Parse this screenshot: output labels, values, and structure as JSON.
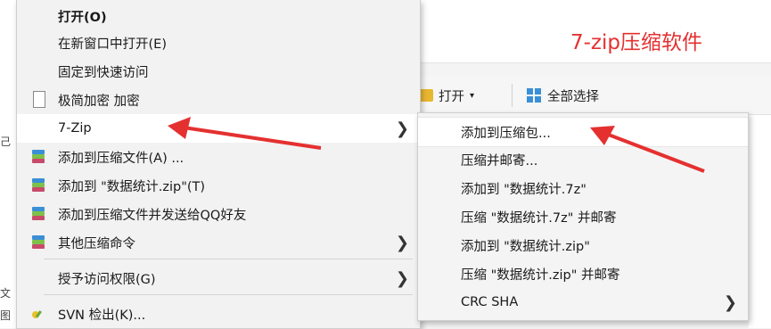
{
  "caption": "7-zip压缩软件",
  "ribbon": {
    "open_label": "打开",
    "open_caret": "▾",
    "select_all_label": "全部选择"
  },
  "bg_fragments": [
    "己",
    "文",
    "¿",
    "图"
  ],
  "main_menu": {
    "items": [
      {
        "label": "打开(O)",
        "bold": true
      },
      {
        "label": "在新窗口中打开(E)"
      },
      {
        "label": "固定到快速访问"
      },
      {
        "label": "极简加密 加密"
      },
      {
        "label": "7-Zip",
        "has_submenu": true,
        "highlighted": true
      },
      {
        "label": "添加到压缩文件(A) ..."
      },
      {
        "label": "添加到 \"数据统计.zip\"(T)"
      },
      {
        "label": "添加到压缩文件并发送给QQ好友"
      },
      {
        "label": "其他压缩命令",
        "has_submenu": true
      },
      {
        "label": "授予访问权限(G)",
        "has_submenu": true
      },
      {
        "label": "SVN 检出(K)..."
      }
    ]
  },
  "sub_menu": {
    "items": [
      {
        "label": "添加到压缩包...",
        "highlighted": true
      },
      {
        "label": "压缩并邮寄..."
      },
      {
        "label": "添加到 \"数据统计.7z\""
      },
      {
        "label": "压缩 \"数据统计.7z\" 并邮寄"
      },
      {
        "label": "添加到 \"数据统计.zip\""
      },
      {
        "label": "压缩 \"数据统计.zip\" 并邮寄"
      },
      {
        "label": "CRC SHA",
        "has_submenu": true
      }
    ]
  },
  "submenu_arrow": "❯",
  "colors": {
    "annotation_red": "#e53030",
    "menu_bg": "#f2f2f2",
    "highlight_bg": "#ffffff"
  }
}
